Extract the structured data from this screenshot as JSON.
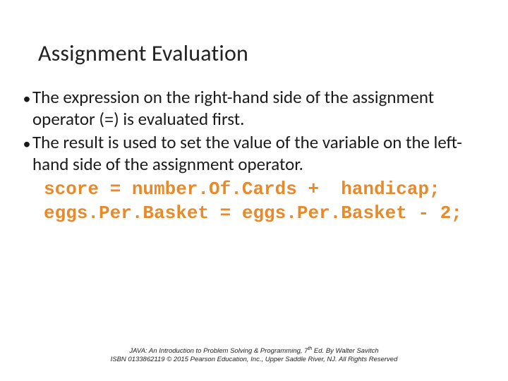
{
  "title": "Assignment Evaluation",
  "bullets": [
    {
      "pre": "The expression on the right-hand side of the assignment operator (",
      "mono": "=",
      "post": ") is evaluated first."
    },
    {
      "text": "The result is used to set the value of the variable on the left-hand side of the assignment operator."
    }
  ],
  "code": [
    "score = number.Of.Cards +  handicap;",
    "eggs.Per.Basket = eggs.Per.Basket - 2;"
  ],
  "footer": {
    "line1a": "JAVA: An Introduction to Problem Solving & Programming, 7",
    "ord": "th",
    "line1b": " Ed. By Walter Savitch",
    "line2": "ISBN 0133862119 © 2015 Pearson Education, Inc., Upper Saddle River, NJ. All Rights Reserved"
  },
  "colors": {
    "code": "#e78a2b",
    "text": "#1a1a1a"
  }
}
